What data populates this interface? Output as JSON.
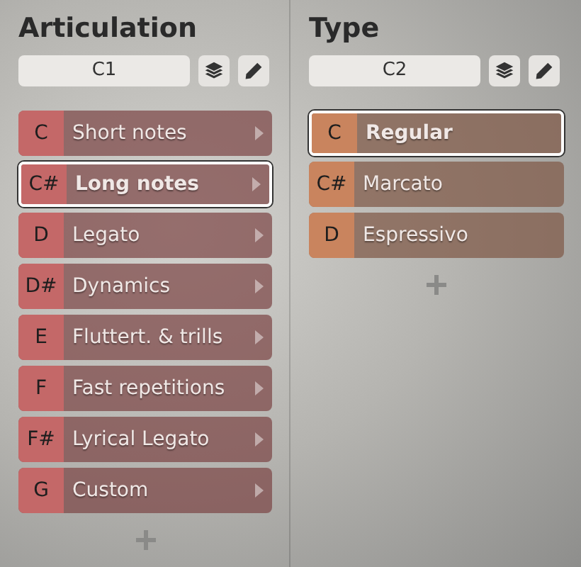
{
  "columns": [
    {
      "title": "Articulation",
      "field": {
        "value": "C1"
      },
      "color": "#c46868",
      "items": [
        {
          "key": "C",
          "label": "Short notes",
          "selected": false,
          "kind": "submenu"
        },
        {
          "key": "C#",
          "label": "Long notes",
          "selected": true,
          "kind": "submenu"
        },
        {
          "key": "D",
          "label": "Legato",
          "selected": false,
          "kind": "submenu"
        },
        {
          "key": "D#",
          "label": "Dynamics",
          "selected": false,
          "kind": "submenu"
        },
        {
          "key": "E",
          "label": "Fluttert. & trills",
          "selected": false,
          "kind": "submenu"
        },
        {
          "key": "F",
          "label": "Fast repetitions",
          "selected": false,
          "kind": "submenu"
        },
        {
          "key": "F#",
          "label": "Lyrical Legato",
          "selected": false,
          "kind": "submenu"
        },
        {
          "key": "G",
          "label": "Custom",
          "selected": false,
          "kind": "submenu"
        }
      ]
    },
    {
      "title": "Type",
      "field": {
        "value": "C2"
      },
      "color": "#c9845e",
      "items": [
        {
          "key": "C",
          "label": "Regular",
          "selected": true,
          "kind": "plain"
        },
        {
          "key": "C#",
          "label": "Marcato",
          "selected": false,
          "kind": "plain"
        },
        {
          "key": "D",
          "label": "Espressivo",
          "selected": false,
          "kind": "plain"
        }
      ]
    }
  ]
}
